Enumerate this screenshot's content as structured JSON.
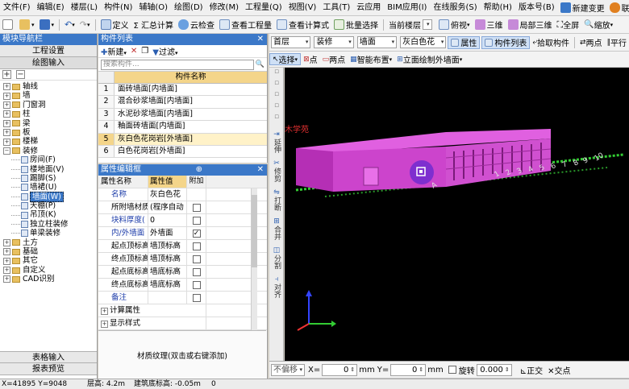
{
  "menubar": {
    "items": [
      "文件(F)",
      "编辑(E)",
      "楼层(L)",
      "构件(N)",
      "辅轴(O)",
      "绘图(D)",
      "修改(M)",
      "工程量(Q)",
      "视图(V)",
      "工具(T)",
      "云应用",
      "BIM应用(I)",
      "在线服务(S)",
      "帮助(H)",
      "版本号(B)"
    ],
    "new_change": "新建变更",
    "contact": "联系客服"
  },
  "toolbar1": {
    "define": "定义",
    "sum_calc": "Σ 汇总计算",
    "cloud_check": "云检查",
    "view_quantity": "查看工程量",
    "view_formula": "查看计算式",
    "batch_select": "批量选择",
    "current_floor": "当前楼层",
    "top_view": "俯视",
    "three_d": "三维",
    "partial_3d": "局部三维",
    "fullscreen": "全屏",
    "zoom": "缩放"
  },
  "toolbar2": {
    "floor": "首层",
    "category": "装修",
    "component_type": "墙面",
    "component": "灰白色花",
    "properties": "属性",
    "component_list": "构件列表",
    "pick_component": "拾取构件",
    "two_points": "两点",
    "parallel": "平行"
  },
  "toolbar3": {
    "select": "选择",
    "point": "点",
    "two_points": "两点",
    "smart_layout": "智能布置",
    "elevation_draw": "立面绘制外墙面"
  },
  "left_panel": {
    "title": "模块导航栏",
    "tab_project": "工程设置",
    "tab_draw": "绘图输入",
    "tree": [
      {
        "label": "轴线",
        "level": 0,
        "exp": "+",
        "type": "folder"
      },
      {
        "label": "墙",
        "level": 0,
        "exp": "+",
        "type": "folder"
      },
      {
        "label": "门窗洞",
        "level": 0,
        "exp": "+",
        "type": "folder"
      },
      {
        "label": "柱",
        "level": 0,
        "exp": "+",
        "type": "folder"
      },
      {
        "label": "梁",
        "level": 0,
        "exp": "+",
        "type": "folder"
      },
      {
        "label": "板",
        "level": 0,
        "exp": "+",
        "type": "folder"
      },
      {
        "label": "楼梯",
        "level": 0,
        "exp": "+",
        "type": "folder"
      },
      {
        "label": "装修",
        "level": 0,
        "exp": "-",
        "type": "folder"
      },
      {
        "label": "房间(F)",
        "level": 1,
        "exp": "",
        "type": "leaf"
      },
      {
        "label": "楼地面(V)",
        "level": 1,
        "exp": "",
        "type": "leaf"
      },
      {
        "label": "踢脚(S)",
        "level": 1,
        "exp": "",
        "type": "leaf"
      },
      {
        "label": "墙裙(U)",
        "level": 1,
        "exp": "",
        "type": "leaf"
      },
      {
        "label": "墙面(W)",
        "level": 1,
        "exp": "",
        "type": "leaf",
        "selected": true
      },
      {
        "label": "天棚(P)",
        "level": 1,
        "exp": "",
        "type": "leaf"
      },
      {
        "label": "吊顶(K)",
        "level": 1,
        "exp": "",
        "type": "leaf"
      },
      {
        "label": "独立柱装修",
        "level": 1,
        "exp": "",
        "type": "leaf"
      },
      {
        "label": "单梁装修",
        "level": 1,
        "exp": "",
        "type": "leaf"
      },
      {
        "label": "土方",
        "level": 0,
        "exp": "+",
        "type": "folder"
      },
      {
        "label": "基础",
        "level": 0,
        "exp": "+",
        "type": "folder"
      },
      {
        "label": "其它",
        "level": 0,
        "exp": "+",
        "type": "folder"
      },
      {
        "label": "自定义",
        "level": 0,
        "exp": "+",
        "type": "folder"
      },
      {
        "label": "CAD识别",
        "level": 0,
        "exp": "+",
        "type": "folder"
      }
    ],
    "bottom_tab_table": "表格输入",
    "bottom_tab_report": "报表预览"
  },
  "component_list": {
    "title": "构件列表",
    "new_label": "新建",
    "filter_label": "过滤",
    "search_placeholder": "搜索构件...",
    "header": "构件名称",
    "rows": [
      {
        "num": "1",
        "name": "面砖墙面[内墙面]"
      },
      {
        "num": "2",
        "name": "混合砂浆墙面[内墙面]"
      },
      {
        "num": "3",
        "name": "水泥砂浆墙面[内墙面]"
      },
      {
        "num": "4",
        "name": "釉面砖墙面[内墙面]"
      },
      {
        "num": "5",
        "name": "灰白色花岗岩[外墙面]",
        "selected": true
      },
      {
        "num": "6",
        "name": "白色花岗岩[外墙面]"
      }
    ]
  },
  "property_editor": {
    "title": "属性编辑框",
    "col_name": "属性名称",
    "col_value": "属性值",
    "col_extra": "附加",
    "rows": [
      {
        "name": "名称",
        "value": "灰白色花",
        "check": "none",
        "blue": true
      },
      {
        "name": "所附墙材质",
        "value": "(程序自动",
        "check": "empty",
        "blue": false
      },
      {
        "name": "块料厚度(",
        "value": "0",
        "check": "empty",
        "blue": true
      },
      {
        "name": "内/外墙面",
        "value": "外墙面",
        "check": "checked",
        "blue": true
      },
      {
        "name": "起点顶标高",
        "value": "墙顶标高",
        "check": "empty",
        "blue": false
      },
      {
        "name": "终点顶标高",
        "value": "墙顶标高",
        "check": "empty",
        "blue": false
      },
      {
        "name": "起点底标高",
        "value": "墙底标高",
        "check": "empty",
        "blue": false
      },
      {
        "name": "终点底标高",
        "value": "墙底标高",
        "check": "empty",
        "blue": false
      },
      {
        "name": "备注",
        "value": "",
        "check": "empty",
        "blue": true
      }
    ],
    "group_calc": "计算属性",
    "group_display": "显示样式",
    "texture_hint": "材质纹理(双击或右键添加)"
  },
  "vstrip": {
    "items": [
      "延伸",
      "修剪",
      "打断",
      "合并",
      "分割",
      "对齐"
    ]
  },
  "viewport": {
    "watermark": "土木学苑",
    "axis_labels": [
      "1",
      "2",
      "3",
      "4",
      "5",
      "6",
      "7",
      "8",
      "9",
      "10",
      "A"
    ]
  },
  "bottom_bar": {
    "no_offset": "不偏移",
    "x_label": "X=",
    "x_value": "0",
    "mm_label": "mm",
    "y_label": "Y=",
    "y_value": "0",
    "mm_label2": "mm",
    "rotate_label": "旋转",
    "rotate_value": "0.000",
    "orthogonal": "正交",
    "intersection": "交点"
  },
  "statusbar": {
    "coords": "X=41895 Y=9048",
    "floor_height": "层高: 4.2m",
    "base_elev": "建筑底标高: -0.05m",
    "extra": "0"
  },
  "colors": {
    "accent_blue": "#3b78c8",
    "building_magenta": "#cc44cc",
    "axis_green": "#33cc33",
    "selected_row": "#fff2c8"
  }
}
